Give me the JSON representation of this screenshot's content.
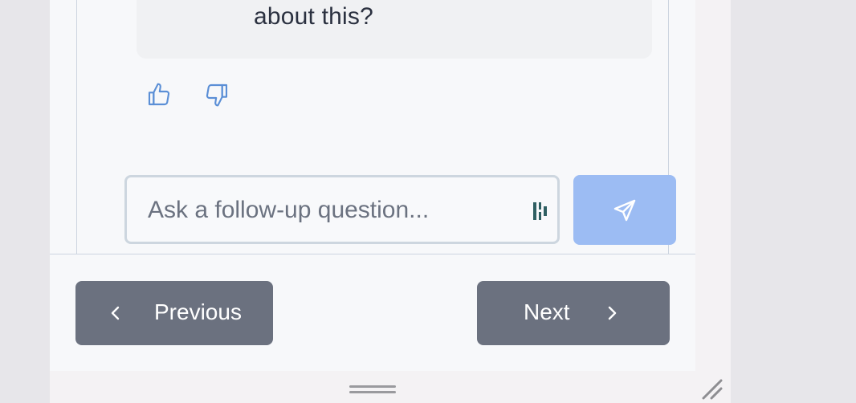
{
  "chat": {
    "assistant_message_tail": "about this?",
    "feedback": {
      "thumbs_up_icon": "thumbs-up-icon",
      "thumbs_down_icon": "thumbs-down-icon"
    },
    "followup_input": {
      "value": "",
      "placeholder": "Ask a follow-up question..."
    },
    "send_icon": "paper-plane-icon"
  },
  "navigation": {
    "previous_label": "Previous",
    "next_label": "Next"
  },
  "colors": {
    "accent_icon": "#5b8fd6",
    "send_button_bg": "#9cbcf3",
    "nav_button_bg": "#6b717f",
    "grammar_icon": "#2f5f62"
  }
}
